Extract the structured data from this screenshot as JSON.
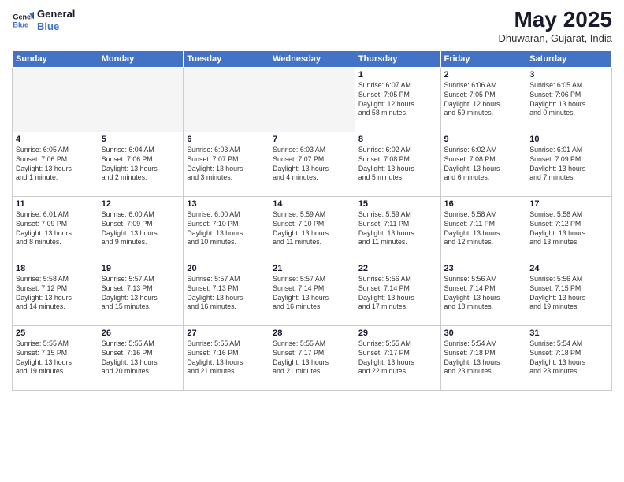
{
  "logo": {
    "line1": "General",
    "line2": "Blue"
  },
  "title": "May 2025",
  "subtitle": "Dhuwaran, Gujarat, India",
  "weekdays": [
    "Sunday",
    "Monday",
    "Tuesday",
    "Wednesday",
    "Thursday",
    "Friday",
    "Saturday"
  ],
  "weeks": [
    [
      {
        "day": "",
        "info": ""
      },
      {
        "day": "",
        "info": ""
      },
      {
        "day": "",
        "info": ""
      },
      {
        "day": "",
        "info": ""
      },
      {
        "day": "1",
        "info": "Sunrise: 6:07 AM\nSunset: 7:05 PM\nDaylight: 12 hours\nand 58 minutes."
      },
      {
        "day": "2",
        "info": "Sunrise: 6:06 AM\nSunset: 7:05 PM\nDaylight: 12 hours\nand 59 minutes."
      },
      {
        "day": "3",
        "info": "Sunrise: 6:05 AM\nSunset: 7:06 PM\nDaylight: 13 hours\nand 0 minutes."
      }
    ],
    [
      {
        "day": "4",
        "info": "Sunrise: 6:05 AM\nSunset: 7:06 PM\nDaylight: 13 hours\nand 1 minute."
      },
      {
        "day": "5",
        "info": "Sunrise: 6:04 AM\nSunset: 7:06 PM\nDaylight: 13 hours\nand 2 minutes."
      },
      {
        "day": "6",
        "info": "Sunrise: 6:03 AM\nSunset: 7:07 PM\nDaylight: 13 hours\nand 3 minutes."
      },
      {
        "day": "7",
        "info": "Sunrise: 6:03 AM\nSunset: 7:07 PM\nDaylight: 13 hours\nand 4 minutes."
      },
      {
        "day": "8",
        "info": "Sunrise: 6:02 AM\nSunset: 7:08 PM\nDaylight: 13 hours\nand 5 minutes."
      },
      {
        "day": "9",
        "info": "Sunrise: 6:02 AM\nSunset: 7:08 PM\nDaylight: 13 hours\nand 6 minutes."
      },
      {
        "day": "10",
        "info": "Sunrise: 6:01 AM\nSunset: 7:09 PM\nDaylight: 13 hours\nand 7 minutes."
      }
    ],
    [
      {
        "day": "11",
        "info": "Sunrise: 6:01 AM\nSunset: 7:09 PM\nDaylight: 13 hours\nand 8 minutes."
      },
      {
        "day": "12",
        "info": "Sunrise: 6:00 AM\nSunset: 7:09 PM\nDaylight: 13 hours\nand 9 minutes."
      },
      {
        "day": "13",
        "info": "Sunrise: 6:00 AM\nSunset: 7:10 PM\nDaylight: 13 hours\nand 10 minutes."
      },
      {
        "day": "14",
        "info": "Sunrise: 5:59 AM\nSunset: 7:10 PM\nDaylight: 13 hours\nand 11 minutes."
      },
      {
        "day": "15",
        "info": "Sunrise: 5:59 AM\nSunset: 7:11 PM\nDaylight: 13 hours\nand 11 minutes."
      },
      {
        "day": "16",
        "info": "Sunrise: 5:58 AM\nSunset: 7:11 PM\nDaylight: 13 hours\nand 12 minutes."
      },
      {
        "day": "17",
        "info": "Sunrise: 5:58 AM\nSunset: 7:12 PM\nDaylight: 13 hours\nand 13 minutes."
      }
    ],
    [
      {
        "day": "18",
        "info": "Sunrise: 5:58 AM\nSunset: 7:12 PM\nDaylight: 13 hours\nand 14 minutes."
      },
      {
        "day": "19",
        "info": "Sunrise: 5:57 AM\nSunset: 7:13 PM\nDaylight: 13 hours\nand 15 minutes."
      },
      {
        "day": "20",
        "info": "Sunrise: 5:57 AM\nSunset: 7:13 PM\nDaylight: 13 hours\nand 16 minutes."
      },
      {
        "day": "21",
        "info": "Sunrise: 5:57 AM\nSunset: 7:14 PM\nDaylight: 13 hours\nand 16 minutes."
      },
      {
        "day": "22",
        "info": "Sunrise: 5:56 AM\nSunset: 7:14 PM\nDaylight: 13 hours\nand 17 minutes."
      },
      {
        "day": "23",
        "info": "Sunrise: 5:56 AM\nSunset: 7:14 PM\nDaylight: 13 hours\nand 18 minutes."
      },
      {
        "day": "24",
        "info": "Sunrise: 5:56 AM\nSunset: 7:15 PM\nDaylight: 13 hours\nand 19 minutes."
      }
    ],
    [
      {
        "day": "25",
        "info": "Sunrise: 5:55 AM\nSunset: 7:15 PM\nDaylight: 13 hours\nand 19 minutes."
      },
      {
        "day": "26",
        "info": "Sunrise: 5:55 AM\nSunset: 7:16 PM\nDaylight: 13 hours\nand 20 minutes."
      },
      {
        "day": "27",
        "info": "Sunrise: 5:55 AM\nSunset: 7:16 PM\nDaylight: 13 hours\nand 21 minutes."
      },
      {
        "day": "28",
        "info": "Sunrise: 5:55 AM\nSunset: 7:17 PM\nDaylight: 13 hours\nand 21 minutes."
      },
      {
        "day": "29",
        "info": "Sunrise: 5:55 AM\nSunset: 7:17 PM\nDaylight: 13 hours\nand 22 minutes."
      },
      {
        "day": "30",
        "info": "Sunrise: 5:54 AM\nSunset: 7:18 PM\nDaylight: 13 hours\nand 23 minutes."
      },
      {
        "day": "31",
        "info": "Sunrise: 5:54 AM\nSunset: 7:18 PM\nDaylight: 13 hours\nand 23 minutes."
      }
    ]
  ]
}
